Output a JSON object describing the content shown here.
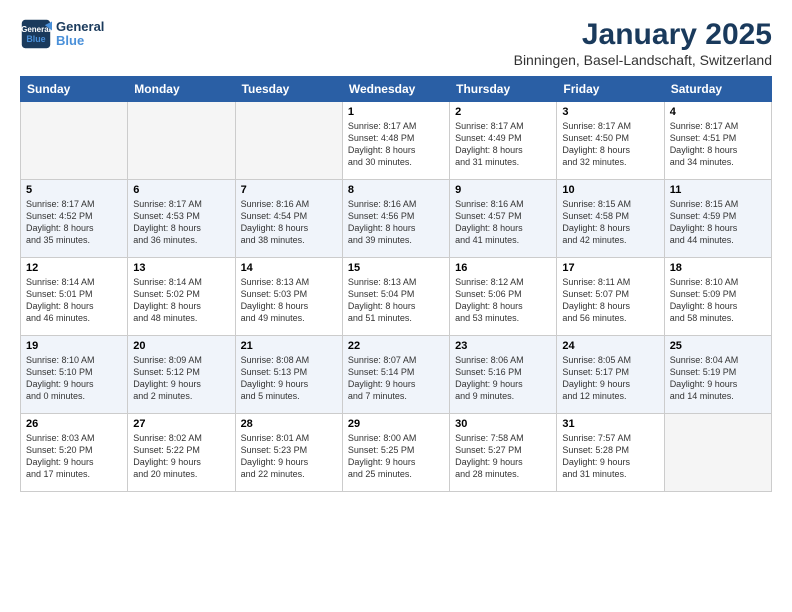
{
  "header": {
    "logo_line1": "General",
    "logo_line2": "Blue",
    "month_title": "January 2025",
    "subtitle": "Binningen, Basel-Landschaft, Switzerland"
  },
  "weekdays": [
    "Sunday",
    "Monday",
    "Tuesday",
    "Wednesday",
    "Thursday",
    "Friday",
    "Saturday"
  ],
  "weeks": [
    [
      {
        "day": "",
        "info": ""
      },
      {
        "day": "",
        "info": ""
      },
      {
        "day": "",
        "info": ""
      },
      {
        "day": "1",
        "info": "Sunrise: 8:17 AM\nSunset: 4:48 PM\nDaylight: 8 hours\nand 30 minutes."
      },
      {
        "day": "2",
        "info": "Sunrise: 8:17 AM\nSunset: 4:49 PM\nDaylight: 8 hours\nand 31 minutes."
      },
      {
        "day": "3",
        "info": "Sunrise: 8:17 AM\nSunset: 4:50 PM\nDaylight: 8 hours\nand 32 minutes."
      },
      {
        "day": "4",
        "info": "Sunrise: 8:17 AM\nSunset: 4:51 PM\nDaylight: 8 hours\nand 34 minutes."
      }
    ],
    [
      {
        "day": "5",
        "info": "Sunrise: 8:17 AM\nSunset: 4:52 PM\nDaylight: 8 hours\nand 35 minutes."
      },
      {
        "day": "6",
        "info": "Sunrise: 8:17 AM\nSunset: 4:53 PM\nDaylight: 8 hours\nand 36 minutes."
      },
      {
        "day": "7",
        "info": "Sunrise: 8:16 AM\nSunset: 4:54 PM\nDaylight: 8 hours\nand 38 minutes."
      },
      {
        "day": "8",
        "info": "Sunrise: 8:16 AM\nSunset: 4:56 PM\nDaylight: 8 hours\nand 39 minutes."
      },
      {
        "day": "9",
        "info": "Sunrise: 8:16 AM\nSunset: 4:57 PM\nDaylight: 8 hours\nand 41 minutes."
      },
      {
        "day": "10",
        "info": "Sunrise: 8:15 AM\nSunset: 4:58 PM\nDaylight: 8 hours\nand 42 minutes."
      },
      {
        "day": "11",
        "info": "Sunrise: 8:15 AM\nSunset: 4:59 PM\nDaylight: 8 hours\nand 44 minutes."
      }
    ],
    [
      {
        "day": "12",
        "info": "Sunrise: 8:14 AM\nSunset: 5:01 PM\nDaylight: 8 hours\nand 46 minutes."
      },
      {
        "day": "13",
        "info": "Sunrise: 8:14 AM\nSunset: 5:02 PM\nDaylight: 8 hours\nand 48 minutes."
      },
      {
        "day": "14",
        "info": "Sunrise: 8:13 AM\nSunset: 5:03 PM\nDaylight: 8 hours\nand 49 minutes."
      },
      {
        "day": "15",
        "info": "Sunrise: 8:13 AM\nSunset: 5:04 PM\nDaylight: 8 hours\nand 51 minutes."
      },
      {
        "day": "16",
        "info": "Sunrise: 8:12 AM\nSunset: 5:06 PM\nDaylight: 8 hours\nand 53 minutes."
      },
      {
        "day": "17",
        "info": "Sunrise: 8:11 AM\nSunset: 5:07 PM\nDaylight: 8 hours\nand 56 minutes."
      },
      {
        "day": "18",
        "info": "Sunrise: 8:10 AM\nSunset: 5:09 PM\nDaylight: 8 hours\nand 58 minutes."
      }
    ],
    [
      {
        "day": "19",
        "info": "Sunrise: 8:10 AM\nSunset: 5:10 PM\nDaylight: 9 hours\nand 0 minutes."
      },
      {
        "day": "20",
        "info": "Sunrise: 8:09 AM\nSunset: 5:12 PM\nDaylight: 9 hours\nand 2 minutes."
      },
      {
        "day": "21",
        "info": "Sunrise: 8:08 AM\nSunset: 5:13 PM\nDaylight: 9 hours\nand 5 minutes."
      },
      {
        "day": "22",
        "info": "Sunrise: 8:07 AM\nSunset: 5:14 PM\nDaylight: 9 hours\nand 7 minutes."
      },
      {
        "day": "23",
        "info": "Sunrise: 8:06 AM\nSunset: 5:16 PM\nDaylight: 9 hours\nand 9 minutes."
      },
      {
        "day": "24",
        "info": "Sunrise: 8:05 AM\nSunset: 5:17 PM\nDaylight: 9 hours\nand 12 minutes."
      },
      {
        "day": "25",
        "info": "Sunrise: 8:04 AM\nSunset: 5:19 PM\nDaylight: 9 hours\nand 14 minutes."
      }
    ],
    [
      {
        "day": "26",
        "info": "Sunrise: 8:03 AM\nSunset: 5:20 PM\nDaylight: 9 hours\nand 17 minutes."
      },
      {
        "day": "27",
        "info": "Sunrise: 8:02 AM\nSunset: 5:22 PM\nDaylight: 9 hours\nand 20 minutes."
      },
      {
        "day": "28",
        "info": "Sunrise: 8:01 AM\nSunset: 5:23 PM\nDaylight: 9 hours\nand 22 minutes."
      },
      {
        "day": "29",
        "info": "Sunrise: 8:00 AM\nSunset: 5:25 PM\nDaylight: 9 hours\nand 25 minutes."
      },
      {
        "day": "30",
        "info": "Sunrise: 7:58 AM\nSunset: 5:27 PM\nDaylight: 9 hours\nand 28 minutes."
      },
      {
        "day": "31",
        "info": "Sunrise: 7:57 AM\nSunset: 5:28 PM\nDaylight: 9 hours\nand 31 minutes."
      },
      {
        "day": "",
        "info": ""
      }
    ]
  ]
}
